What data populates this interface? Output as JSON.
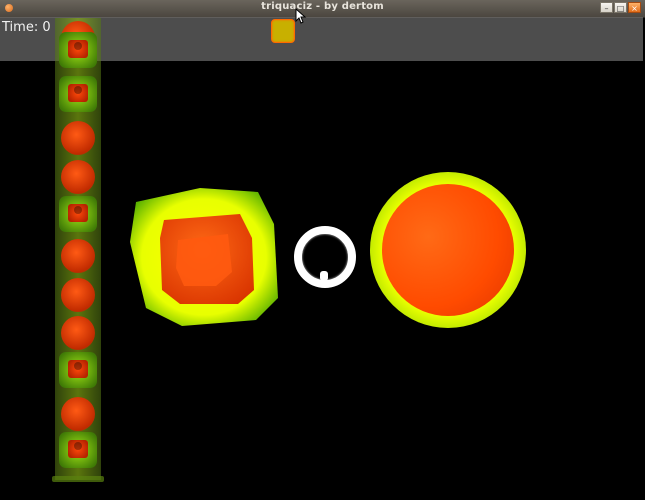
{
  "window": {
    "title": "triquaciz - by dertom",
    "buttons": {
      "minimize": "–",
      "maximize": "□",
      "close": "×"
    }
  },
  "hud": {
    "time_label": "Time: 0"
  },
  "icons": {
    "app": "app-dot-icon",
    "cursor": "mouse-cursor-icon",
    "hud_piece": "yellow-square-icon"
  },
  "colors": {
    "background": "#000000",
    "accent_orange": "#ff4b00",
    "accent_yellow": "#e8ff00",
    "tower_green": "#7fbf10",
    "ring_white": "#ffffff"
  },
  "tower": {
    "cells": [
      "circle",
      "square",
      "square",
      "circle",
      "circle",
      "square",
      "circle",
      "circle",
      "circle",
      "square",
      "circle",
      "square"
    ]
  },
  "board_pieces": [
    "square",
    "ring",
    "circle"
  ]
}
